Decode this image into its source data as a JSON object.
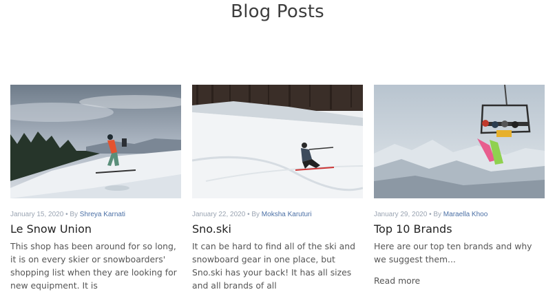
{
  "page": {
    "title": "Blog Posts"
  },
  "posts": [
    {
      "date": "January 15, 2020",
      "by": "• By",
      "author": "Shreya Karnati",
      "title": "Le Snow Union",
      "excerpt": "This shop has been around for so long, it is on every skier or snowboarders' shopping list when they are looking for new equipment. It is",
      "image": "skier-on-slope-photo"
    },
    {
      "date": "January 22, 2020",
      "by": "• By",
      "author": "Moksha Karuturi",
      "title": "Sno.ski",
      "excerpt": "It can be hard to find all of the ski and snowboard gear in one place, but Sno.ski has your back! It has all sizes and all brands of all",
      "image": "skier-carving-photo"
    },
    {
      "date": "January 29, 2020",
      "by": "• By",
      "author": "Maraella Khoo",
      "title": "Top 10 Brands",
      "excerpt": "Here are our top ten brands and why we suggest them...",
      "read_more": "Read more",
      "image": "chairlift-photo"
    }
  ]
}
